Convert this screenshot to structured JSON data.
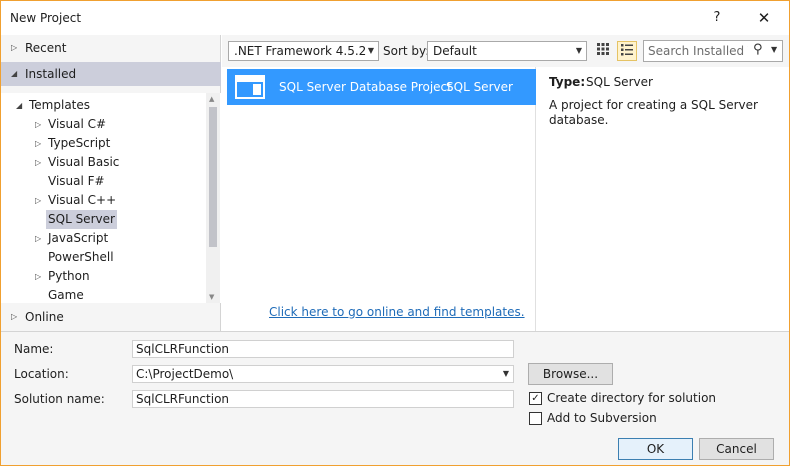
{
  "window": {
    "title": "New Project",
    "help_glyph": "?",
    "close_glyph": "✕"
  },
  "sidebar": {
    "recent_label": "Recent",
    "installed_label": "Installed",
    "online_label": "Online",
    "tree": {
      "root_label": "Templates",
      "items": [
        {
          "label": "Visual C#",
          "expandable": true
        },
        {
          "label": "TypeScript",
          "expandable": true
        },
        {
          "label": "Visual Basic",
          "expandable": true
        },
        {
          "label": "Visual F#",
          "expandable": false
        },
        {
          "label": "Visual C++",
          "expandable": true
        },
        {
          "label": "SQL Server",
          "expandable": false,
          "selected": true
        },
        {
          "label": "JavaScript",
          "expandable": true
        },
        {
          "label": "PowerShell",
          "expandable": false
        },
        {
          "label": "Python",
          "expandable": true
        },
        {
          "label": "Game",
          "expandable": false
        }
      ]
    }
  },
  "toolbar": {
    "framework_value": ".NET Framework 4.5.2",
    "sort_label": "Sort by:",
    "sort_value": "Default",
    "search_placeholder": "Search Installed Ter",
    "grid_view_icon": "grid-view-icon",
    "list_view_icon": "list-view-icon"
  },
  "templates": {
    "items": [
      {
        "name": "SQL Server Database Project",
        "type": "SQL Server",
        "selected": true
      }
    ],
    "online_link": "Click here to go online and find templates."
  },
  "description": {
    "type_label": "Type:",
    "type_value": "SQL Server",
    "text": "A project for creating a SQL Server database."
  },
  "form": {
    "name_label": "Name:",
    "name_value": "SqlCLRFunction",
    "location_label": "Location:",
    "location_value": "C:\\ProjectDemo\\",
    "solution_label": "Solution name:",
    "solution_value": "SqlCLRFunction",
    "browse_label": "Browse...",
    "create_dir_label": "Create directory for solution",
    "create_dir_checked": true,
    "subversion_label": "Add to Subversion",
    "subversion_checked": false,
    "ok_label": "OK",
    "cancel_label": "Cancel"
  },
  "colors": {
    "accent": "#3399ff",
    "window_border": "#f0a030",
    "selection": "#cccedb",
    "link": "#1e6bb8"
  }
}
